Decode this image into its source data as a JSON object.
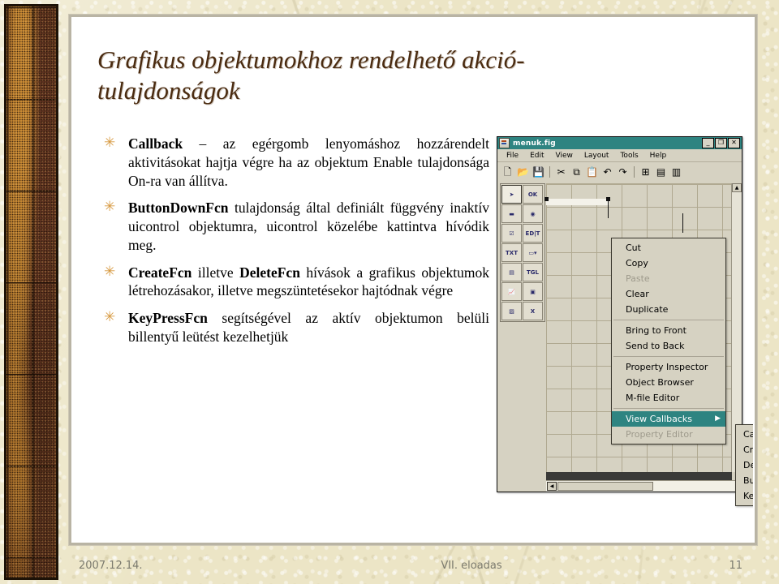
{
  "slide": {
    "title": "Grafikus objektumokhoz rendelhető akció-tulajdonságok",
    "bullets": [
      {
        "icon": "star-bullet-icon",
        "segments": [
          {
            "text": "Callback",
            "bold": true
          },
          {
            "text": " – az egérgomb lenyomáshoz hozzárendelt aktivitásokat hajtja végre ha az objektum Enable tulajdonsága On-ra van állítva.",
            "bold": false
          }
        ]
      },
      {
        "icon": "star-bullet-icon",
        "segments": [
          {
            "text": "ButtonDownFcn",
            "bold": true
          },
          {
            "text": " tulajdonság által definiált függvény inaktív uicontrol objektumra, uicontrol közelébe kattintva hívódik meg.",
            "bold": false
          }
        ]
      },
      {
        "icon": "star-bullet-icon",
        "segments": [
          {
            "text": "CreateFcn",
            "bold": true
          },
          {
            "text": " illetve ",
            "bold": false
          },
          {
            "text": "DeleteFcn",
            "bold": true
          },
          {
            "text": " hívások a grafikus objektumok létrehozásakor, illetve megszüntetésekor hajtódnak végre",
            "bold": false
          }
        ]
      },
      {
        "icon": "star-bullet-icon",
        "segments": [
          {
            "text": "KeyPressFcn",
            "bold": true
          },
          {
            "text": " segítségével az aktív objektumon belüli billentyű leütést kezelhetjük",
            "bold": false
          }
        ]
      }
    ]
  },
  "figure_window": {
    "title": "menuk.fig",
    "title_icon": "guide-figure-icon",
    "titlebar_color": "#2e8481",
    "window_buttons": [
      {
        "name": "minimize-button",
        "glyph": "_"
      },
      {
        "name": "maximize-button",
        "glyph": "❐"
      },
      {
        "name": "close-button",
        "glyph": "✕"
      }
    ],
    "menubar": [
      "File",
      "Edit",
      "View",
      "Layout",
      "Tools",
      "Help"
    ],
    "toolbar": [
      {
        "name": "new-icon",
        "glyph": "🗋"
      },
      {
        "name": "open-icon",
        "glyph": "📂"
      },
      {
        "name": "save-icon",
        "glyph": "💾"
      },
      {
        "name": "separator",
        "glyph": ""
      },
      {
        "name": "cut-icon",
        "glyph": "✂"
      },
      {
        "name": "copy-icon",
        "glyph": "⧉"
      },
      {
        "name": "paste-icon",
        "glyph": "📋"
      },
      {
        "name": "undo-icon",
        "glyph": "↶"
      },
      {
        "name": "redo-icon",
        "glyph": "↷"
      },
      {
        "name": "separator",
        "glyph": ""
      },
      {
        "name": "align-objects-icon",
        "glyph": "⊞"
      },
      {
        "name": "menu-editor-icon",
        "glyph": "▤"
      },
      {
        "name": "m-file-editor-icon",
        "glyph": "▥"
      }
    ],
    "palette": [
      {
        "name": "select-tool",
        "label": "➤",
        "selected": true
      },
      {
        "name": "push-button-tool",
        "label": "OK"
      },
      {
        "name": "slider-tool",
        "label": "▬"
      },
      {
        "name": "radio-button-tool",
        "label": "◉"
      },
      {
        "name": "checkbox-tool",
        "label": "☑"
      },
      {
        "name": "edit-text-tool",
        "label": "ED|T"
      },
      {
        "name": "static-text-tool",
        "label": "TXT"
      },
      {
        "name": "popup-menu-tool",
        "label": "▭▾"
      },
      {
        "name": "listbox-tool",
        "label": "▤"
      },
      {
        "name": "toggle-button-tool",
        "label": "TGL"
      },
      {
        "name": "axes-tool",
        "label": "📈"
      },
      {
        "name": "panel-tool",
        "label": "▣"
      },
      {
        "name": "button-group-tool",
        "label": "▨"
      },
      {
        "name": "activex-tool",
        "label": "X"
      }
    ],
    "context_menu": [
      {
        "label": "Cut",
        "state": "normal"
      },
      {
        "label": "Copy",
        "state": "normal"
      },
      {
        "label": "Paste",
        "state": "disabled"
      },
      {
        "label": "Clear",
        "state": "normal"
      },
      {
        "label": "Duplicate",
        "state": "normal"
      },
      {
        "label": "",
        "state": "separator"
      },
      {
        "label": "Bring to Front",
        "state": "normal"
      },
      {
        "label": "Send to Back",
        "state": "normal"
      },
      {
        "label": "",
        "state": "separator"
      },
      {
        "label": "Property Inspector",
        "state": "normal"
      },
      {
        "label": "Object Browser",
        "state": "normal"
      },
      {
        "label": "M-file Editor",
        "state": "normal"
      },
      {
        "label": "",
        "state": "separator"
      },
      {
        "label": "View Callbacks",
        "state": "highlighted",
        "submenu_arrow": "▶"
      },
      {
        "label": "Property Editor",
        "state": "disabled"
      }
    ],
    "submenu": [
      {
        "label": "Callback"
      },
      {
        "label": "CreateFcn"
      },
      {
        "label": "DeleteFcn"
      },
      {
        "label": "ButtonDownFcn"
      },
      {
        "label": "KeyPressFcn"
      }
    ]
  },
  "footer": {
    "date": "2007.12.14.",
    "center": "VII. eloadas",
    "page": "11"
  }
}
